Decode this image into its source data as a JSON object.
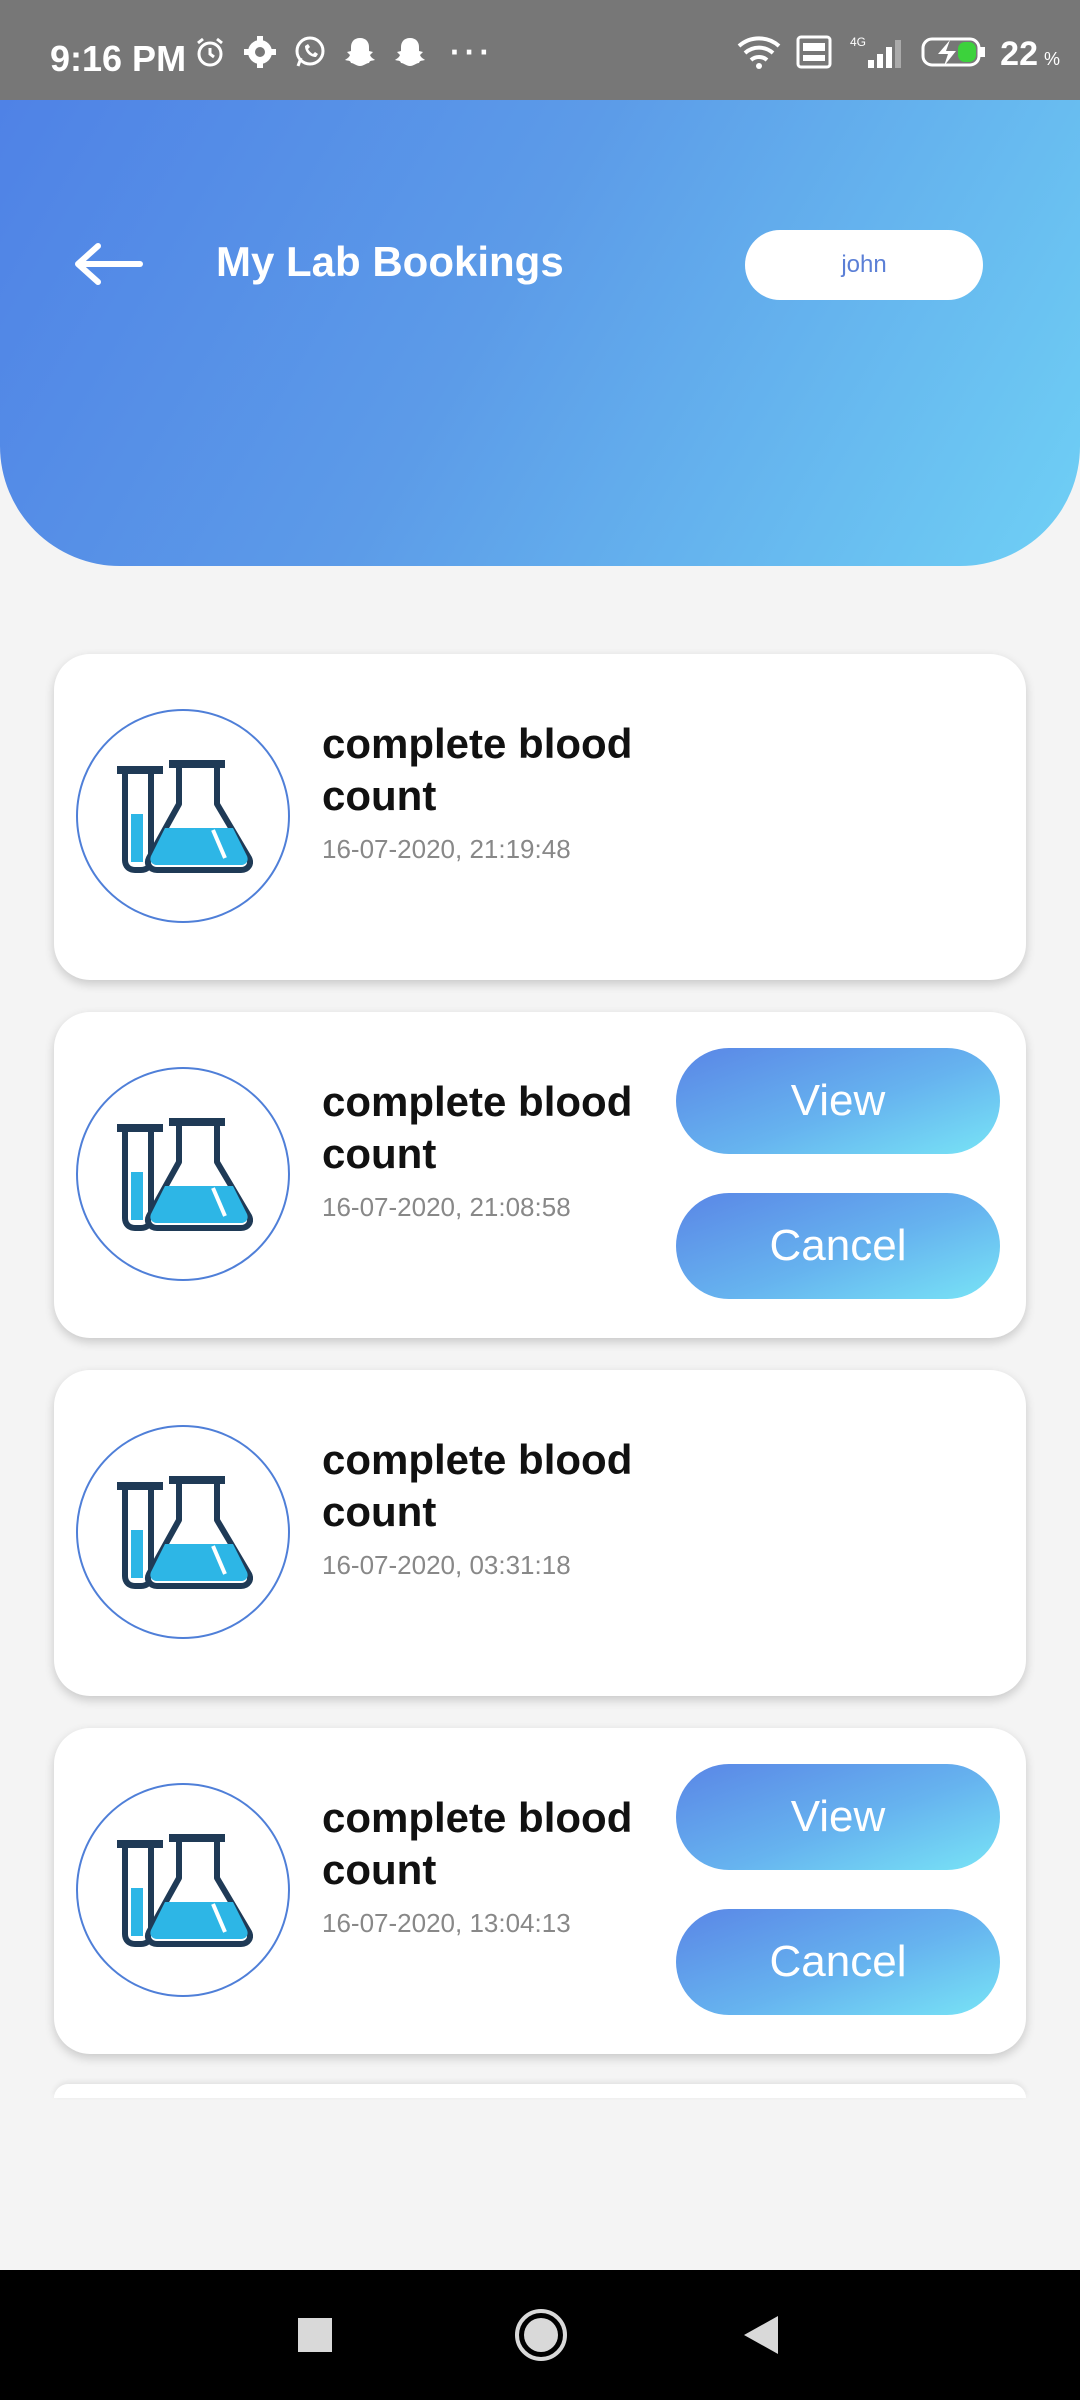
{
  "status_bar": {
    "time": "9:16 PM",
    "battery_percent": "22",
    "battery_unit": "%",
    "icons_left": [
      "alarm-icon",
      "settings-icon",
      "whatsapp-icon",
      "snapchat-icon",
      "snapchat-icon",
      "more-dots-icon"
    ],
    "icons_right": [
      "wifi-icon",
      "volte-icon",
      "signal-4g-icon",
      "battery-charging-icon"
    ]
  },
  "header": {
    "title": "My Lab Bookings",
    "user_name": "john",
    "gradient_start": "#4f82e6",
    "gradient_end": "#6fd0f5"
  },
  "bookings": [
    {
      "title": "complete blood count",
      "datetime": "16-07-2020, 21:19:48",
      "has_actions": false
    },
    {
      "title": "complete blood count",
      "datetime": "16-07-2020, 21:08:58",
      "has_actions": true,
      "view_label": "View",
      "cancel_label": "Cancel"
    },
    {
      "title": "complete blood count",
      "datetime": "16-07-2020, 03:31:18",
      "has_actions": false
    },
    {
      "title": "complete blood count",
      "datetime": "16-07-2020, 13:04:13",
      "has_actions": true,
      "view_label": "View",
      "cancel_label": "Cancel"
    }
  ],
  "nav_bar": {
    "buttons": [
      "recents-square-icon",
      "home-circle-icon",
      "back-triangle-icon"
    ]
  }
}
